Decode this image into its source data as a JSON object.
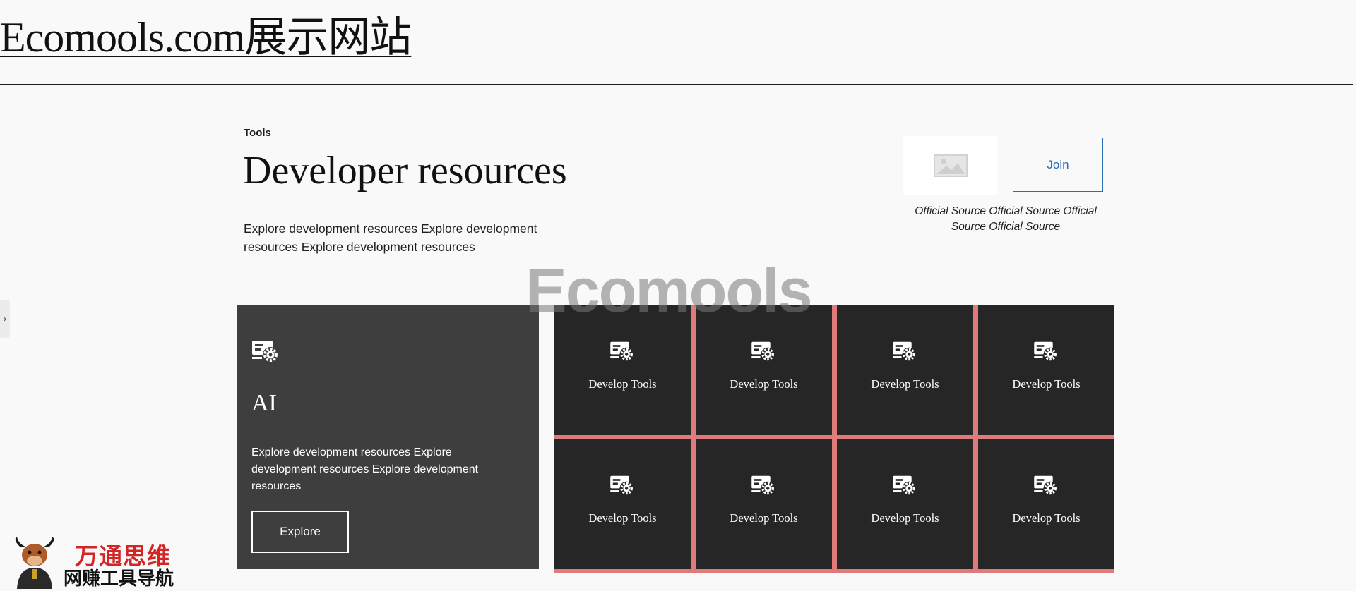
{
  "header": {
    "site_title": "Ecomools.com展示网站"
  },
  "intro": {
    "eyebrow": "Tools",
    "heading": "Developer resources",
    "text": "Explore development resources Explore development resources Explore development resources"
  },
  "promo": {
    "image_icon": "image-placeholder-icon",
    "join_label": "Join",
    "caption": "Official Source Official Source Official Source Official Source"
  },
  "watermark": {
    "text": "Ecomools"
  },
  "feature": {
    "icon": "tools-gear-icon",
    "title": "AI",
    "text": "Explore development resources Explore development resources Explore development resources",
    "button_label": "Explore"
  },
  "tiles": [
    {
      "label": "Develop Tools",
      "icon": "tools-gear-icon"
    },
    {
      "label": "Develop Tools",
      "icon": "tools-gear-icon"
    },
    {
      "label": "Develop Tools",
      "icon": "tools-gear-icon"
    },
    {
      "label": "Develop Tools",
      "icon": "tools-gear-icon"
    },
    {
      "label": "Develop Tools",
      "icon": "tools-gear-icon"
    },
    {
      "label": "Develop Tools",
      "icon": "tools-gear-icon"
    },
    {
      "label": "Develop Tools",
      "icon": "tools-gear-icon"
    },
    {
      "label": "Develop Tools",
      "icon": "tools-gear-icon"
    }
  ],
  "brand_badge": {
    "name": "万通思维",
    "tagline": "网赚工具导航",
    "mascot_icon": "bull-mascot-icon"
  },
  "colors": {
    "background": "#f9f9f9",
    "tile_gap": "#e07b7b",
    "tile_bg": "#262626",
    "feature_bg": "#3e3e3e",
    "join_border": "#2a6fb5",
    "brand_red": "#d32525"
  }
}
